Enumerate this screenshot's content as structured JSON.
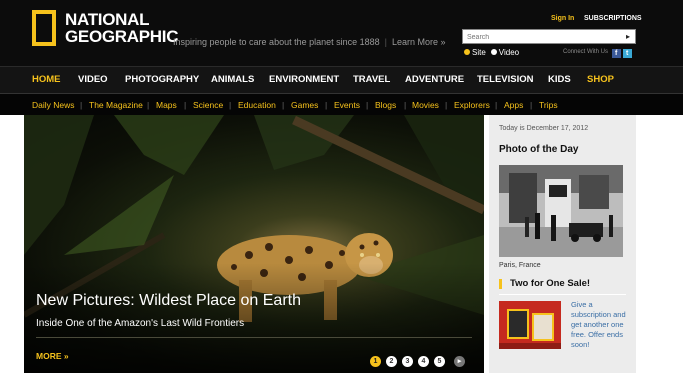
{
  "header": {
    "logo_line1": "NATIONAL",
    "logo_line2": "GEOGRAPHIC",
    "tagline": "Inspiring people to care about the planet since 1888",
    "learn_more": "Learn More »",
    "sign_in": "Sign In",
    "subscriptions": "SUBSCRIPTIONS",
    "search_placeholder": "Search",
    "search_scope": [
      "Site",
      "Video"
    ],
    "search_scope_selected": "Site",
    "connect_label": "Connect With Us",
    "social_icons": [
      "facebook-icon",
      "twitter-icon"
    ]
  },
  "main_nav": [
    {
      "label": "HOME",
      "active": true
    },
    {
      "label": "VIDEO"
    },
    {
      "label": "PHOTOGRAPHY"
    },
    {
      "label": "ANIMALS"
    },
    {
      "label": "ENVIRONMENT"
    },
    {
      "label": "TRAVEL"
    },
    {
      "label": "ADVENTURE"
    },
    {
      "label": "TELEVISION"
    },
    {
      "label": "KIDS"
    },
    {
      "label": "SHOP",
      "highlight": true
    }
  ],
  "sub_nav": [
    "Daily News",
    "The Magazine",
    "Maps",
    "Science",
    "Education",
    "Games",
    "Events",
    "Blogs",
    "Movies",
    "Explorers",
    "Apps",
    "Trips"
  ],
  "hero": {
    "title": "New Pictures: Wildest Place on Earth",
    "subtitle": "Inside One of the Amazon's Last Wild Frontiers",
    "more": "MORE »",
    "pages": [
      "1",
      "2",
      "3",
      "4",
      "5"
    ],
    "active_page": "1",
    "next_icon": "next-arrow-icon"
  },
  "sidebar": {
    "today": "Today is December 17, 2012",
    "photo_of_day_title": "Photo of the Day",
    "photo_caption": "Paris, France",
    "sale_title": "Two for One Sale!",
    "sale_text": "Give a subscription and get another one free. Offer ends soon!"
  },
  "colors": {
    "accent_yellow": "#f6c21c",
    "header_bg": "#0c0c0c",
    "sidebar_bg": "#ececec",
    "link_blue": "#3a6ea5"
  }
}
